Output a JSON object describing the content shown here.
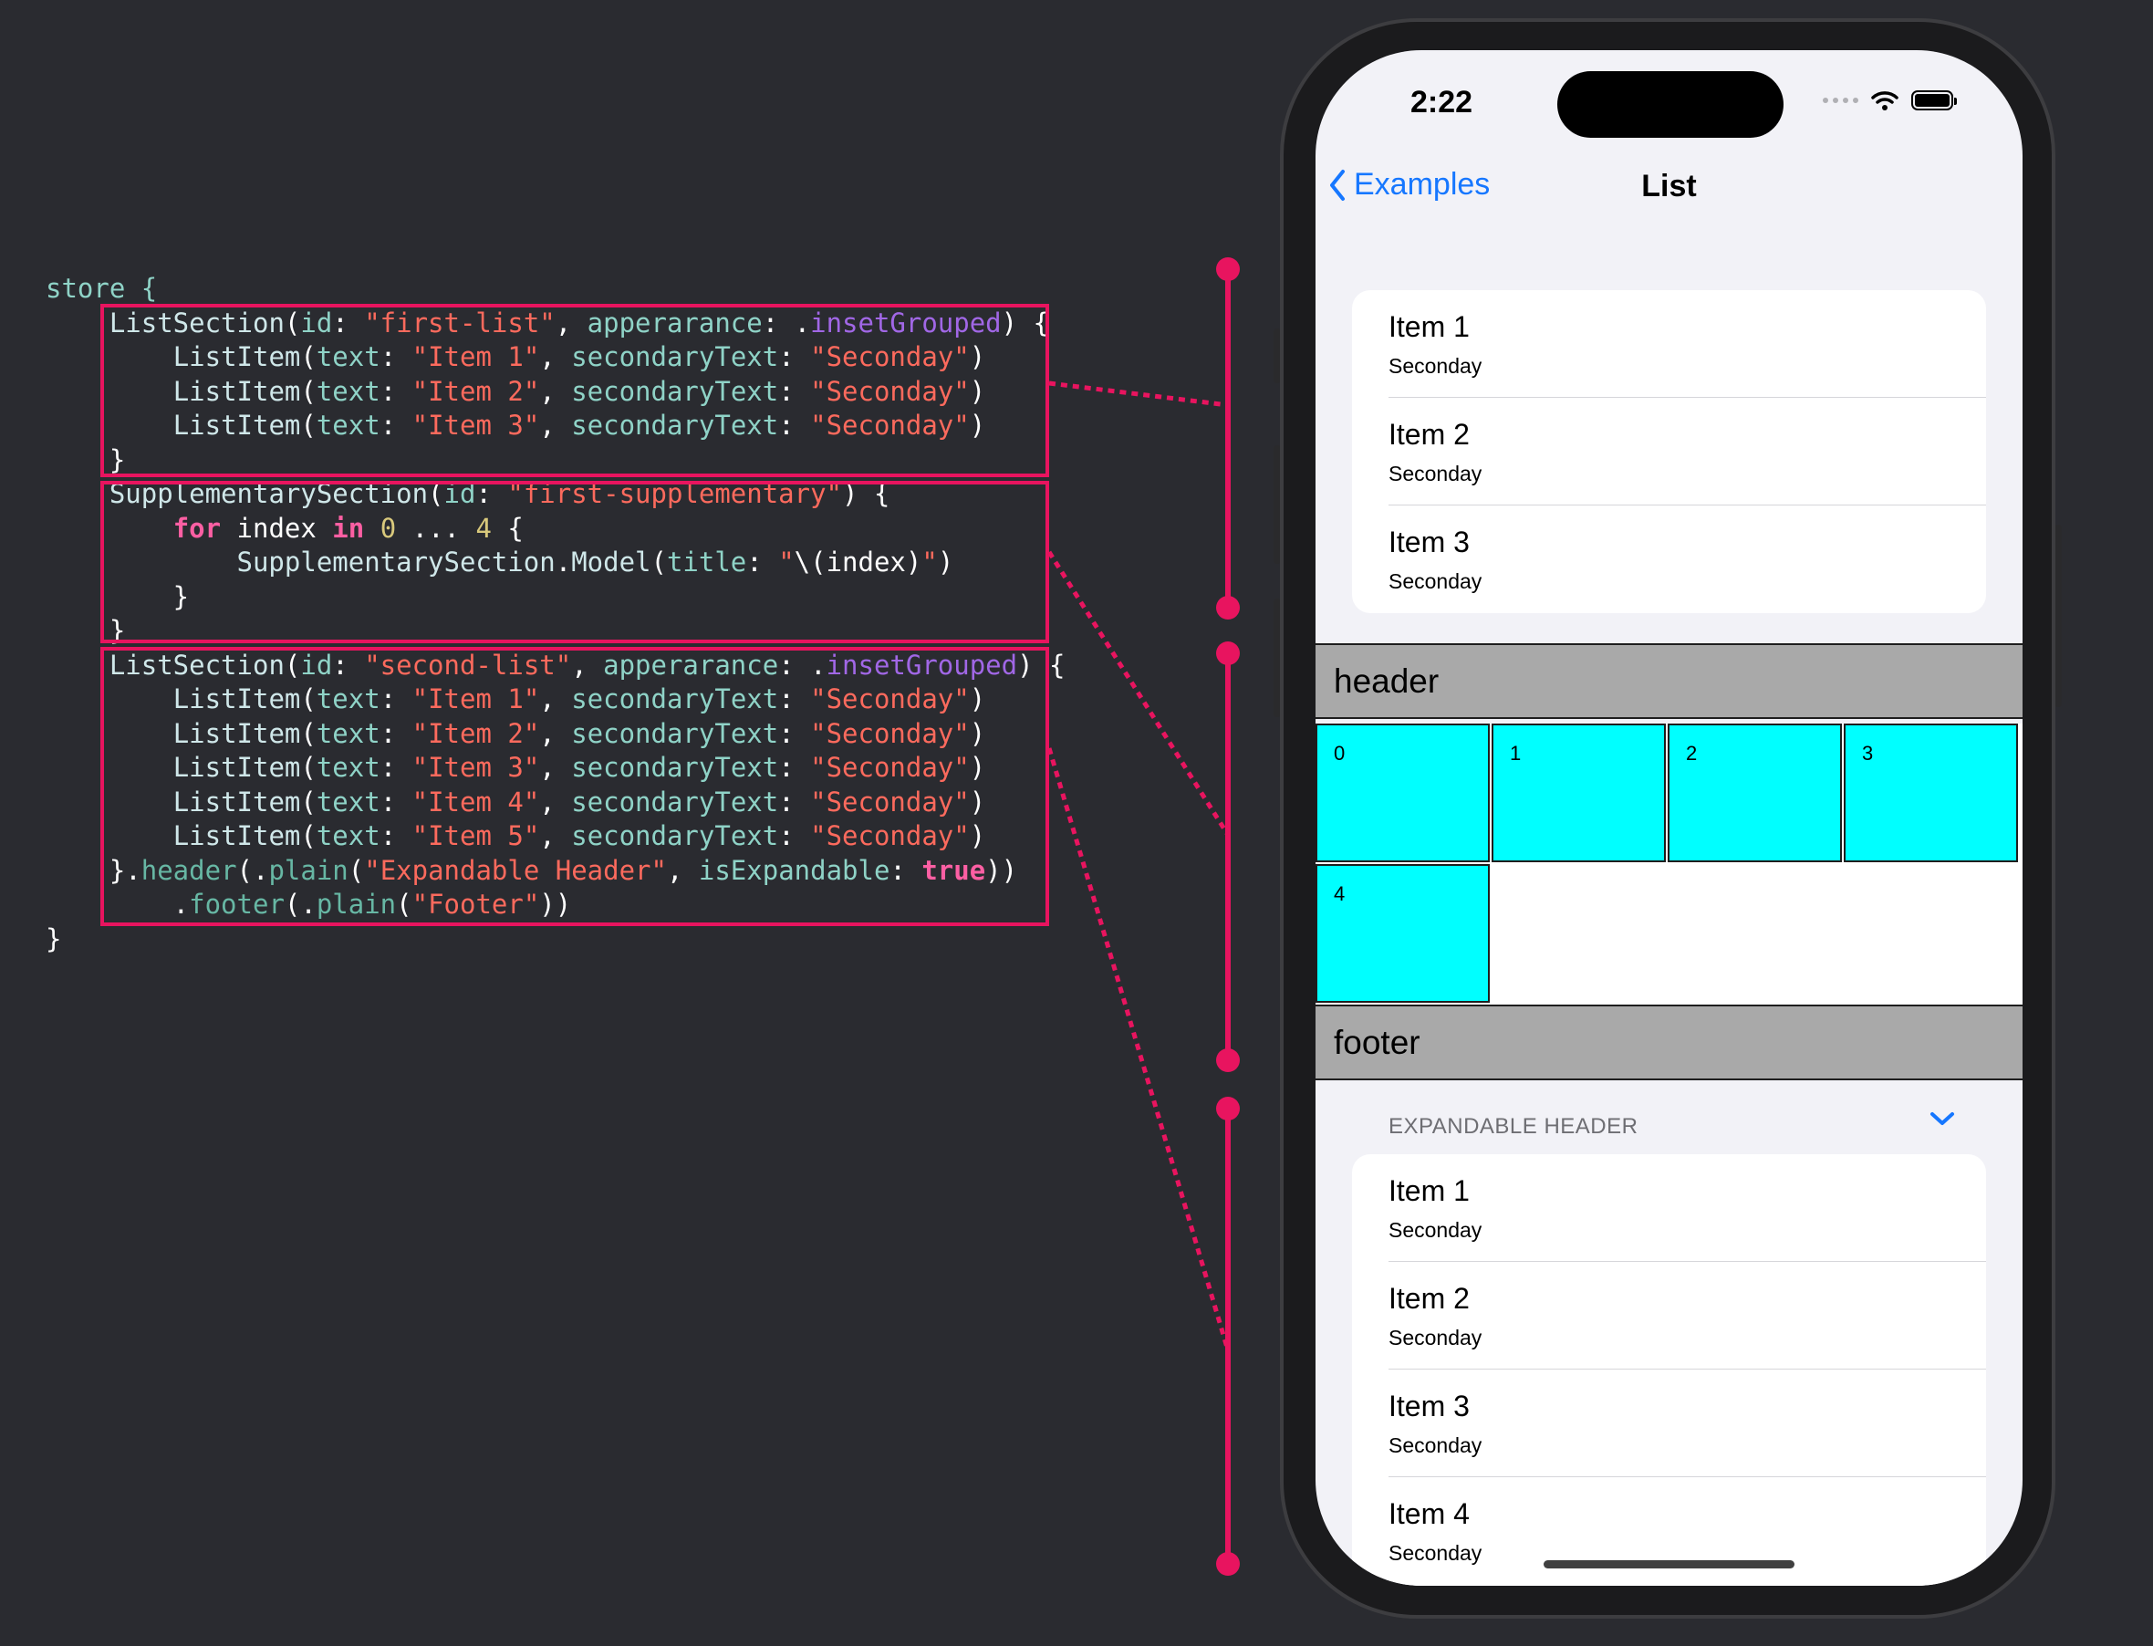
{
  "code": {
    "lines": [
      [
        {
          "t": "store {",
          "c": "t-lbl"
        }
      ],
      [
        {
          "t": "    ",
          "c": "t-plain"
        },
        {
          "t": "ListSection",
          "c": "t-type"
        },
        {
          "t": "(",
          "c": "t-plain"
        },
        {
          "t": "id",
          "c": "t-lbl"
        },
        {
          "t": ": ",
          "c": "t-plain"
        },
        {
          "t": "\"first-list\"",
          "c": "t-str"
        },
        {
          "t": ", ",
          "c": "t-plain"
        },
        {
          "t": "apperarance",
          "c": "t-lbl"
        },
        {
          "t": ": .",
          "c": "t-plain"
        },
        {
          "t": "insetGrouped",
          "c": "t-prop"
        },
        {
          "t": ") {",
          "c": "t-plain"
        }
      ],
      [
        {
          "t": "        ",
          "c": "t-plain"
        },
        {
          "t": "ListItem",
          "c": "t-type"
        },
        {
          "t": "(",
          "c": "t-plain"
        },
        {
          "t": "text",
          "c": "t-lbl"
        },
        {
          "t": ": ",
          "c": "t-plain"
        },
        {
          "t": "\"Item 1\"",
          "c": "t-str"
        },
        {
          "t": ", ",
          "c": "t-plain"
        },
        {
          "t": "secondaryText",
          "c": "t-lbl"
        },
        {
          "t": ": ",
          "c": "t-plain"
        },
        {
          "t": "\"Seconday\"",
          "c": "t-str"
        },
        {
          "t": ")",
          "c": "t-plain"
        }
      ],
      [
        {
          "t": "        ",
          "c": "t-plain"
        },
        {
          "t": "ListItem",
          "c": "t-type"
        },
        {
          "t": "(",
          "c": "t-plain"
        },
        {
          "t": "text",
          "c": "t-lbl"
        },
        {
          "t": ": ",
          "c": "t-plain"
        },
        {
          "t": "\"Item 2\"",
          "c": "t-str"
        },
        {
          "t": ", ",
          "c": "t-plain"
        },
        {
          "t": "secondaryText",
          "c": "t-lbl"
        },
        {
          "t": ": ",
          "c": "t-plain"
        },
        {
          "t": "\"Seconday\"",
          "c": "t-str"
        },
        {
          "t": ")",
          "c": "t-plain"
        }
      ],
      [
        {
          "t": "        ",
          "c": "t-plain"
        },
        {
          "t": "ListItem",
          "c": "t-type"
        },
        {
          "t": "(",
          "c": "t-plain"
        },
        {
          "t": "text",
          "c": "t-lbl"
        },
        {
          "t": ": ",
          "c": "t-plain"
        },
        {
          "t": "\"Item 3\"",
          "c": "t-str"
        },
        {
          "t": ", ",
          "c": "t-plain"
        },
        {
          "t": "secondaryText",
          "c": "t-lbl"
        },
        {
          "t": ": ",
          "c": "t-plain"
        },
        {
          "t": "\"Seconday\"",
          "c": "t-str"
        },
        {
          "t": ")",
          "c": "t-plain"
        }
      ],
      [
        {
          "t": "    }",
          "c": "t-plain"
        }
      ],
      [
        {
          "t": "    ",
          "c": "t-plain"
        },
        {
          "t": "SupplementarySection",
          "c": "t-type"
        },
        {
          "t": "(",
          "c": "t-plain"
        },
        {
          "t": "id",
          "c": "t-lbl"
        },
        {
          "t": ": ",
          "c": "t-plain"
        },
        {
          "t": "\"first-supplementary\"",
          "c": "t-str"
        },
        {
          "t": ") {",
          "c": "t-plain"
        }
      ],
      [
        {
          "t": "        ",
          "c": "t-plain"
        },
        {
          "t": "for",
          "c": "t-kw"
        },
        {
          "t": " index ",
          "c": "t-plain"
        },
        {
          "t": "in",
          "c": "t-kw"
        },
        {
          "t": " ",
          "c": "t-plain"
        },
        {
          "t": "0",
          "c": "t-num"
        },
        {
          "t": " ... ",
          "c": "t-plain"
        },
        {
          "t": "4",
          "c": "t-num"
        },
        {
          "t": " {",
          "c": "t-plain"
        }
      ],
      [
        {
          "t": "            ",
          "c": "t-plain"
        },
        {
          "t": "SupplementarySection",
          "c": "t-type"
        },
        {
          "t": ".",
          "c": "t-plain"
        },
        {
          "t": "Model",
          "c": "t-type"
        },
        {
          "t": "(",
          "c": "t-plain"
        },
        {
          "t": "title",
          "c": "t-lbl"
        },
        {
          "t": ": ",
          "c": "t-plain"
        },
        {
          "t": "\"",
          "c": "t-str"
        },
        {
          "t": "\\(index)",
          "c": "t-plain"
        },
        {
          "t": "\"",
          "c": "t-str"
        },
        {
          "t": ")",
          "c": "t-plain"
        }
      ],
      [
        {
          "t": "        }",
          "c": "t-plain"
        }
      ],
      [
        {
          "t": "    }",
          "c": "t-plain"
        }
      ],
      [
        {
          "t": "    ",
          "c": "t-plain"
        },
        {
          "t": "ListSection",
          "c": "t-type"
        },
        {
          "t": "(",
          "c": "t-plain"
        },
        {
          "t": "id",
          "c": "t-lbl"
        },
        {
          "t": ": ",
          "c": "t-plain"
        },
        {
          "t": "\"second-list\"",
          "c": "t-str"
        },
        {
          "t": ", ",
          "c": "t-plain"
        },
        {
          "t": "apperarance",
          "c": "t-lbl"
        },
        {
          "t": ": .",
          "c": "t-plain"
        },
        {
          "t": "insetGrouped",
          "c": "t-prop"
        },
        {
          "t": ") {",
          "c": "t-plain"
        }
      ],
      [
        {
          "t": "        ",
          "c": "t-plain"
        },
        {
          "t": "ListItem",
          "c": "t-type"
        },
        {
          "t": "(",
          "c": "t-plain"
        },
        {
          "t": "text",
          "c": "t-lbl"
        },
        {
          "t": ": ",
          "c": "t-plain"
        },
        {
          "t": "\"Item 1\"",
          "c": "t-str"
        },
        {
          "t": ", ",
          "c": "t-plain"
        },
        {
          "t": "secondaryText",
          "c": "t-lbl"
        },
        {
          "t": ": ",
          "c": "t-plain"
        },
        {
          "t": "\"Seconday\"",
          "c": "t-str"
        },
        {
          "t": ")",
          "c": "t-plain"
        }
      ],
      [
        {
          "t": "        ",
          "c": "t-plain"
        },
        {
          "t": "ListItem",
          "c": "t-type"
        },
        {
          "t": "(",
          "c": "t-plain"
        },
        {
          "t": "text",
          "c": "t-lbl"
        },
        {
          "t": ": ",
          "c": "t-plain"
        },
        {
          "t": "\"Item 2\"",
          "c": "t-str"
        },
        {
          "t": ", ",
          "c": "t-plain"
        },
        {
          "t": "secondaryText",
          "c": "t-lbl"
        },
        {
          "t": ": ",
          "c": "t-plain"
        },
        {
          "t": "\"Seconday\"",
          "c": "t-str"
        },
        {
          "t": ")",
          "c": "t-plain"
        }
      ],
      [
        {
          "t": "        ",
          "c": "t-plain"
        },
        {
          "t": "ListItem",
          "c": "t-type"
        },
        {
          "t": "(",
          "c": "t-plain"
        },
        {
          "t": "text",
          "c": "t-lbl"
        },
        {
          "t": ": ",
          "c": "t-plain"
        },
        {
          "t": "\"Item 3\"",
          "c": "t-str"
        },
        {
          "t": ", ",
          "c": "t-plain"
        },
        {
          "t": "secondaryText",
          "c": "t-lbl"
        },
        {
          "t": ": ",
          "c": "t-plain"
        },
        {
          "t": "\"Seconday\"",
          "c": "t-str"
        },
        {
          "t": ")",
          "c": "t-plain"
        }
      ],
      [
        {
          "t": "        ",
          "c": "t-plain"
        },
        {
          "t": "ListItem",
          "c": "t-type"
        },
        {
          "t": "(",
          "c": "t-plain"
        },
        {
          "t": "text",
          "c": "t-lbl"
        },
        {
          "t": ": ",
          "c": "t-plain"
        },
        {
          "t": "\"Item 4\"",
          "c": "t-str"
        },
        {
          "t": ", ",
          "c": "t-plain"
        },
        {
          "t": "secondaryText",
          "c": "t-lbl"
        },
        {
          "t": ": ",
          "c": "t-plain"
        },
        {
          "t": "\"Seconday\"",
          "c": "t-str"
        },
        {
          "t": ")",
          "c": "t-plain"
        }
      ],
      [
        {
          "t": "        ",
          "c": "t-plain"
        },
        {
          "t": "ListItem",
          "c": "t-type"
        },
        {
          "t": "(",
          "c": "t-plain"
        },
        {
          "t": "text",
          "c": "t-lbl"
        },
        {
          "t": ": ",
          "c": "t-plain"
        },
        {
          "t": "\"Item 5\"",
          "c": "t-str"
        },
        {
          "t": ", ",
          "c": "t-plain"
        },
        {
          "t": "secondaryText",
          "c": "t-lbl"
        },
        {
          "t": ": ",
          "c": "t-plain"
        },
        {
          "t": "\"Seconday\"",
          "c": "t-str"
        },
        {
          "t": ")",
          "c": "t-plain"
        }
      ],
      [
        {
          "t": "    }.",
          "c": "t-plain"
        },
        {
          "t": "header",
          "c": "t-fn"
        },
        {
          "t": "(.",
          "c": "t-plain"
        },
        {
          "t": "plain",
          "c": "t-fn"
        },
        {
          "t": "(",
          "c": "t-plain"
        },
        {
          "t": "\"Expandable Header\"",
          "c": "t-str"
        },
        {
          "t": ", ",
          "c": "t-plain"
        },
        {
          "t": "isExpandable",
          "c": "t-lbl"
        },
        {
          "t": ": ",
          "c": "t-plain"
        },
        {
          "t": "true",
          "c": "t-kw"
        },
        {
          "t": "))",
          "c": "t-plain"
        }
      ],
      [
        {
          "t": "        .",
          "c": "t-plain"
        },
        {
          "t": "footer",
          "c": "t-fn"
        },
        {
          "t": "(.",
          "c": "t-plain"
        },
        {
          "t": "plain",
          "c": "t-fn"
        },
        {
          "t": "(",
          "c": "t-plain"
        },
        {
          "t": "\"Footer\"",
          "c": "t-str"
        },
        {
          "t": "))",
          "c": "t-plain"
        }
      ],
      [
        {
          "t": "}",
          "c": "t-plain"
        }
      ]
    ]
  },
  "colors": {
    "highlight": "#e8145f",
    "background": "#2a2b30",
    "accent_blue": "#1677ff",
    "supplementary_tile": "#00ffff",
    "header_footer_bar": "#a9a9a9"
  },
  "phone": {
    "status_bar": {
      "time": "2:22",
      "icons": [
        "signal-dots-icon",
        "wifi-icon",
        "battery-icon"
      ]
    },
    "nav": {
      "back_label": "Examples",
      "title": "List",
      "back_icon": "chevron-left-icon"
    },
    "first_list": {
      "items": [
        {
          "text": "Item 1",
          "secondary": "Seconday"
        },
        {
          "text": "Item 2",
          "secondary": "Seconday"
        },
        {
          "text": "Item 3",
          "secondary": "Seconday"
        }
      ]
    },
    "supplementary": {
      "header": "header",
      "footer": "footer",
      "tiles": [
        "0",
        "1",
        "2",
        "3",
        "4"
      ]
    },
    "second_list": {
      "header": "EXPANDABLE HEADER",
      "chevron_icon": "chevron-down-icon",
      "items": [
        {
          "text": "Item 1",
          "secondary": "Seconday"
        },
        {
          "text": "Item 2",
          "secondary": "Seconday"
        },
        {
          "text": "Item 3",
          "secondary": "Seconday"
        },
        {
          "text": "Item 4",
          "secondary": "Seconday"
        }
      ]
    }
  }
}
